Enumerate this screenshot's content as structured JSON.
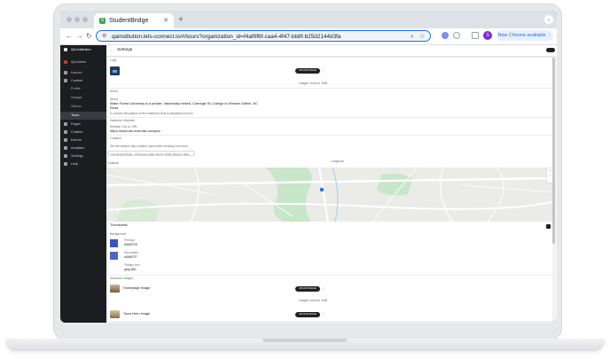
{
  "browser": {
    "tab_title": "StudentBridge",
    "tab_favicon_letter": "S",
    "new_tab_glyph": "+",
    "url": "qainstitution.lets-connect.io/#/tours?organization_id=f4af6f6f-caa4-4f47-bb8f-b25d2144d3fa",
    "profile_initial": "S",
    "chrome_button_label": "New Chrome available",
    "accent": "#1a73e8"
  },
  "sidebar": {
    "org_name": "QA Institution",
    "user_name": "QA Admin",
    "items": [
      {
        "label": "Launch",
        "icon": "rocket-icon"
      },
      {
        "label": "Content",
        "icon": "folder-icon"
      },
      {
        "label": "Profile",
        "icon": "user-icon"
      },
      {
        "label": "Images",
        "icon": "image-icon"
      },
      {
        "label": "Videos",
        "icon": "video-icon"
      },
      {
        "label": "Tours",
        "icon": "map-icon"
      },
      {
        "label": "Pages",
        "icon": "file-icon"
      },
      {
        "label": "Chatbot",
        "icon": "chat-icon"
      },
      {
        "label": "Events",
        "icon": "calendar-icon"
      },
      {
        "label": "Analytics",
        "icon": "chart-icon"
      },
      {
        "label": "Settings",
        "icon": "gear-icon"
      },
      {
        "label": "Help",
        "icon": "help-icon"
      }
    ]
  },
  "header": {
    "title": "Settings"
  },
  "settings": {
    "logo_label": "Logo",
    "upload_label": "UPLOAD IMAGE",
    "logo_hint": "Images must be 1MB",
    "about_label": "About",
    "about_heading": "About",
    "about_text": "Wake Forest University is a private, historically ranked, Carnegie R1 College in Winston-Salem, NC",
    "about_more": "Read",
    "about_hint": "A concise description of the institution that is displayed in tours",
    "website_label": "Institution Website",
    "website_field_label": "Website Link or URL",
    "website_value": "https://www.wfu.edu/visit-campus/",
    "location_label": "Location",
    "location_hint": "Set the default map location used when creating new tours",
    "location_value": "123 Student Bridge, 1234 Aspen Valley Rd NY 12345, Winston, Mass",
    "map_lat_label": "Latitude",
    "map_lng_label": "Longitude",
    "map_water_color": "#a8d4f2",
    "map_park_color": "#c8e6c9",
    "map_road_color": "#ffffff",
    "thumbnails_title": "Thumbnails",
    "background_label": "Background",
    "primary_label": "Primary",
    "primary_value": "#3A5FCB",
    "secondary_label": "Secondary",
    "secondary_value": "#4A6FCF",
    "tertiary_label": "Tertiary text",
    "tertiary_value": "gray-800",
    "swatch_primary": "#3a56b8",
    "swatch_secondary": "#4b67c6",
    "welcome_label": "Welcome Images",
    "welcome_items": [
      {
        "name": "Homepage Image",
        "button": "UPLOAD IMAGE"
      },
      {
        "name": "Tours Hero Image",
        "button": "UPLOAD IMAGE"
      }
    ],
    "welcome_hint": "Images must be 1MB"
  }
}
